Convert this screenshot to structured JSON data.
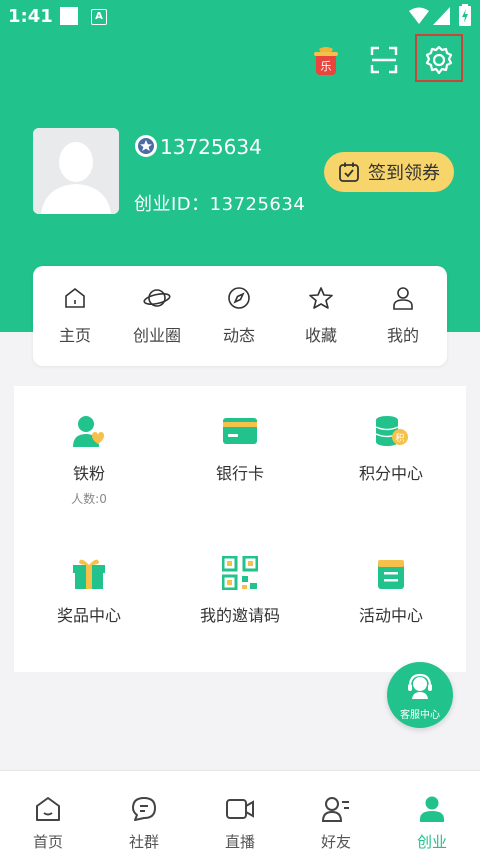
{
  "status_bar": {
    "time": "1:41",
    "a_badge": "A"
  },
  "header": {
    "lucky_badge": "乐",
    "phone": "13725634",
    "user_id": "创业ID：13725634",
    "checkin_label": "签到领券"
  },
  "nav": {
    "items": [
      {
        "label": "主页"
      },
      {
        "label": "创业圈"
      },
      {
        "label": "动态"
      },
      {
        "label": "收藏"
      },
      {
        "label": "我的"
      }
    ]
  },
  "grid": {
    "items": [
      {
        "label": "铁粉",
        "sub": "人数:0"
      },
      {
        "label": "银行卡"
      },
      {
        "label": "积分中心"
      },
      {
        "label": "奖品中心"
      },
      {
        "label": "我的邀请码"
      },
      {
        "label": "活动中心"
      }
    ]
  },
  "service": {
    "label": "客服中心"
  },
  "tabbar": {
    "items": [
      {
        "label": "首页"
      },
      {
        "label": "社群"
      },
      {
        "label": "直播"
      },
      {
        "label": "好友"
      },
      {
        "label": "创业"
      }
    ]
  },
  "colors": {
    "brand": "#22c28c",
    "checkin": "#f7d56a",
    "highlight_border": "#c8453a"
  }
}
